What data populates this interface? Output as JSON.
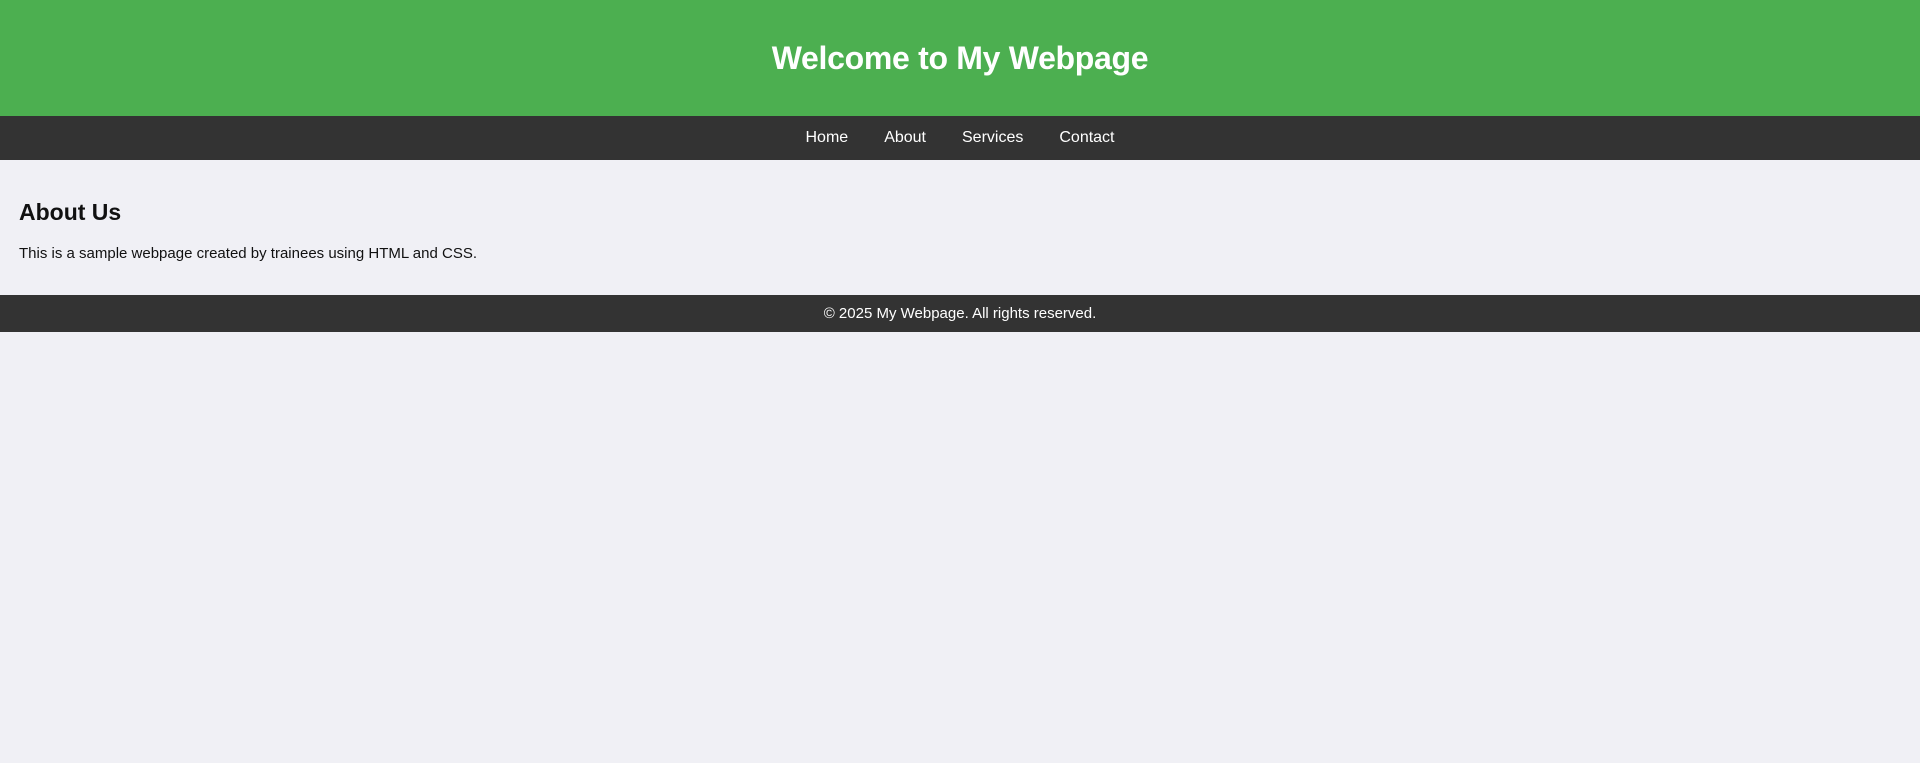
{
  "header": {
    "title": "Welcome to My Webpage"
  },
  "nav": {
    "items": [
      {
        "label": "Home"
      },
      {
        "label": "About"
      },
      {
        "label": "Services"
      },
      {
        "label": "Contact"
      }
    ]
  },
  "main": {
    "heading": "About Us",
    "text": "This is a sample webpage created by trainees using HTML and CSS."
  },
  "footer": {
    "text": "© 2025 My Webpage. All rights reserved."
  },
  "colors": {
    "header_bg": "#4caf50",
    "nav_bg": "#333333",
    "page_bg": "#f0f0f5"
  }
}
